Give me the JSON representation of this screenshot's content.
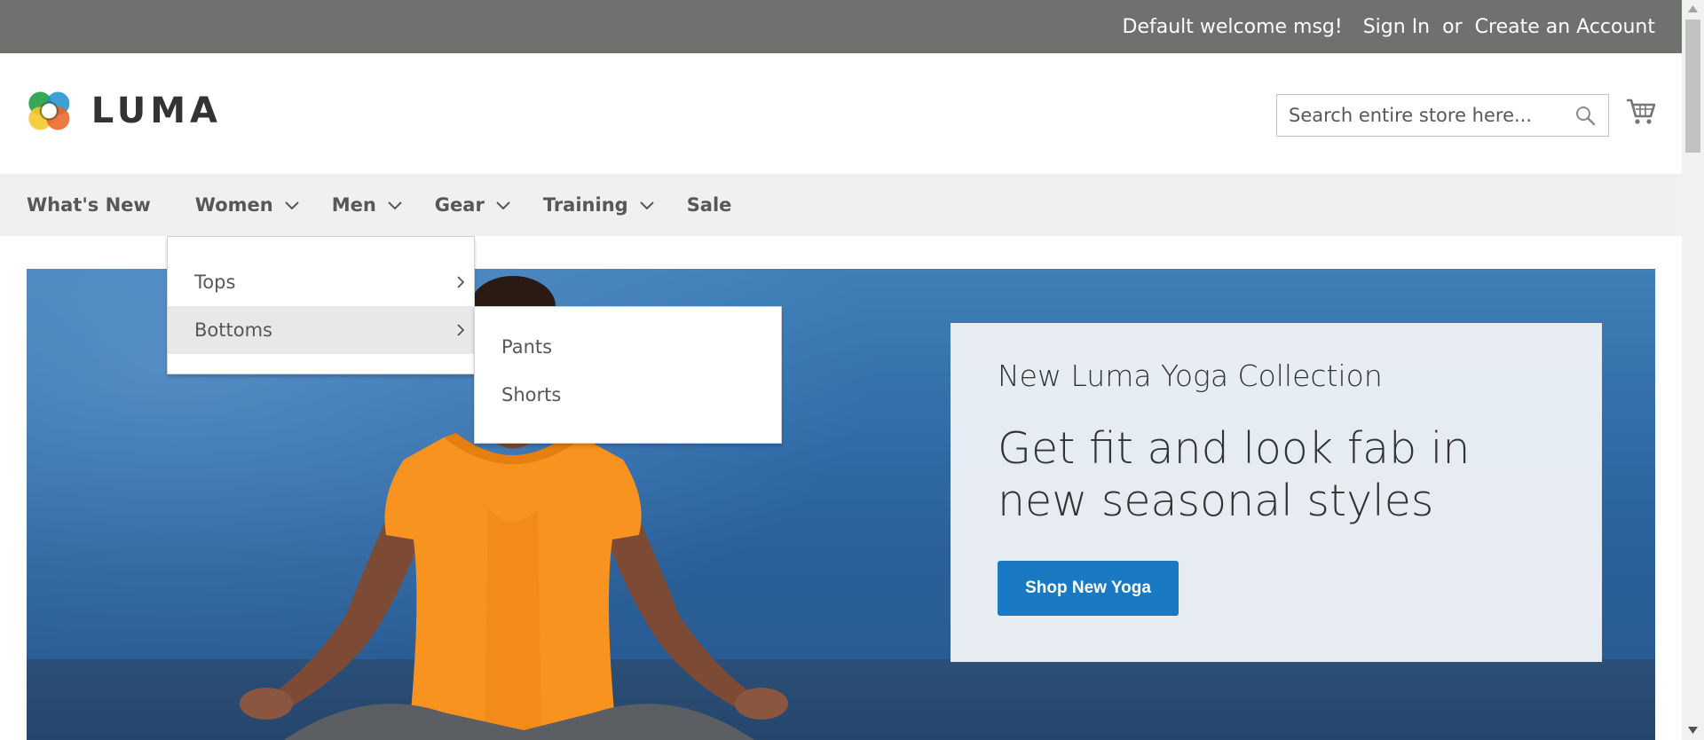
{
  "panel": {
    "welcome": "Default welcome msg!",
    "sign_in": "Sign In",
    "or": "or",
    "create_account": "Create an Account"
  },
  "header": {
    "logo_text": "LUMA",
    "search_placeholder": "Search entire store here...",
    "icons": [
      "luma-logo-icon",
      "search-icon",
      "cart-icon"
    ]
  },
  "nav": {
    "items": [
      {
        "label": "What's New",
        "has_dropdown": false
      },
      {
        "label": "Women",
        "has_dropdown": true
      },
      {
        "label": "Men",
        "has_dropdown": true
      },
      {
        "label": "Gear",
        "has_dropdown": true
      },
      {
        "label": "Training",
        "has_dropdown": true
      },
      {
        "label": "Sale",
        "has_dropdown": false
      }
    ]
  },
  "women_menu": {
    "items": [
      {
        "label": "Tops",
        "active": false
      },
      {
        "label": "Bottoms",
        "active": true
      }
    ]
  },
  "bottoms_menu": {
    "items": [
      {
        "label": "Pants"
      },
      {
        "label": "Shorts"
      }
    ]
  },
  "hero": {
    "subtitle": "New Luma Yoga Collection",
    "title": "Get fit and look fab in new seasonal styles",
    "cta": "Shop New Yoga"
  },
  "colors": {
    "panel_bg": "#6e716e",
    "nav_bg": "#f0f0f0",
    "accent": "#1979c3",
    "text": "#333333"
  }
}
